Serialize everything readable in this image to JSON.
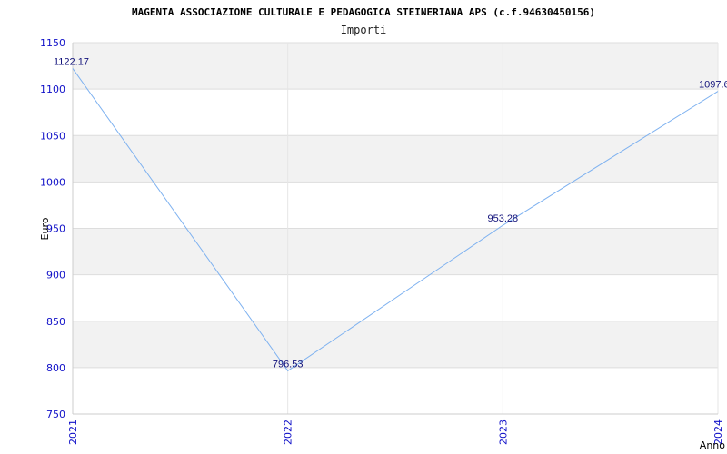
{
  "chart_data": {
    "type": "line",
    "title": "MAGENTA ASSOCIAZIONE CULTURALE E PEDAGOGICA STEINERIANA APS (c.f.94630450156)",
    "subtitle": "Importi",
    "xlabel": "Anno",
    "ylabel": "Euro",
    "categories": [
      "2021",
      "2022",
      "2023",
      "2024"
    ],
    "values": [
      1122.17,
      796.53,
      953.28,
      1097.6
    ],
    "value_labels": [
      "1122.17",
      "796.53",
      "953.28",
      "1097.6"
    ],
    "ylim": [
      750,
      1150
    ],
    "yticks": [
      750,
      800,
      850,
      900,
      950,
      1000,
      1050,
      1100,
      1150
    ],
    "grid": true,
    "line_color": "#7fb2f0",
    "band_color": "#f2f2f2",
    "tick_color": "#1010c8",
    "label_color": "#10107a"
  }
}
